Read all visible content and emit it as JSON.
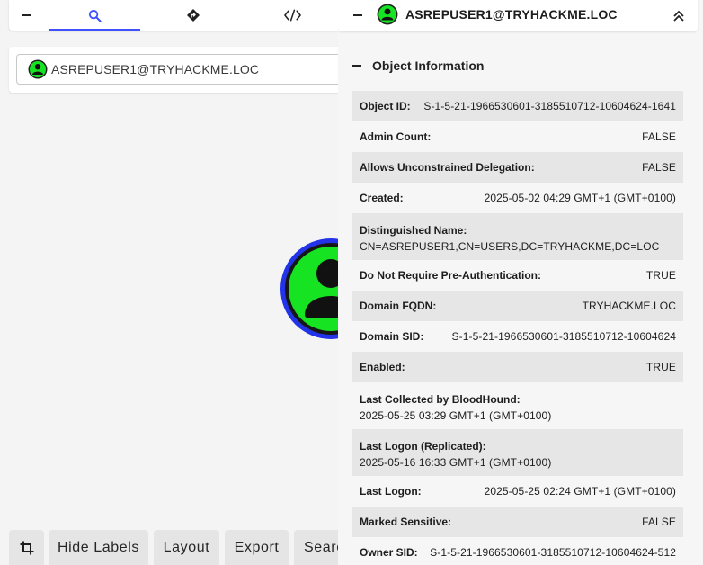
{
  "search": {
    "tabs": [
      {
        "name": "collapse",
        "icon": "minus-icon"
      },
      {
        "name": "search",
        "icon": "search-icon",
        "active": true
      },
      {
        "name": "pathfinding",
        "icon": "route-diamond-icon"
      },
      {
        "name": "cypher",
        "icon": "code-icon"
      }
    ],
    "value": "ASREPUSER1@TRYHACKME.LOC"
  },
  "toolbar": {
    "crop_icon": "crop-icon",
    "hide_labels": "Hide Labels",
    "layout": "Layout",
    "export": "Export",
    "search": "Search"
  },
  "entity_panel": {
    "title": "ASREPUSER1@TRYHACKME.LOC",
    "section_title": "Object Information",
    "rows": [
      {
        "key": "Object ID:",
        "value": "S-1-5-21-1966530601-3185510712-10604624-1641"
      },
      {
        "key": "Admin Count:",
        "value": "FALSE"
      },
      {
        "key": "Allows Unconstrained Delegation:",
        "value": "FALSE"
      },
      {
        "key": "Created:",
        "value": "2025-05-02 04:29 GMT+1 (GMT+0100)"
      },
      {
        "key": "Distinguished Name:",
        "value": "CN=ASREPUSER1,CN=USERS,DC=TRYHACKME,DC=LOC"
      },
      {
        "key": "Do Not Require Pre-Authentication:",
        "value": "TRUE"
      },
      {
        "key": "Domain FQDN:",
        "value": "TRYHACKME.LOC"
      },
      {
        "key": "Domain SID:",
        "value": "S-1-5-21-1966530601-3185510712-10604624"
      },
      {
        "key": "Enabled:",
        "value": "TRUE"
      },
      {
        "key": "Last Collected by BloodHound:",
        "value": "2025-05-25 03:29 GMT+1 (GMT+0100)"
      },
      {
        "key": "Last Logon (Replicated):",
        "value": "2025-05-16 16:33 GMT+1 (GMT+0100)"
      },
      {
        "key": "Last Logon:",
        "value": "2025-05-25 02:24 GMT+1 (GMT+0100)"
      },
      {
        "key": "Marked Sensitive:",
        "value": "FALSE"
      },
      {
        "key": "Owner SID:",
        "value": "S-1-5-21-1966530601-3185510712-10604624-512"
      }
    ]
  },
  "colors": {
    "user_node_fill": "#16e322",
    "user_node_ring": "#2233e8",
    "accent": "#3f51ff",
    "row_shade": "#e6e6e6"
  }
}
